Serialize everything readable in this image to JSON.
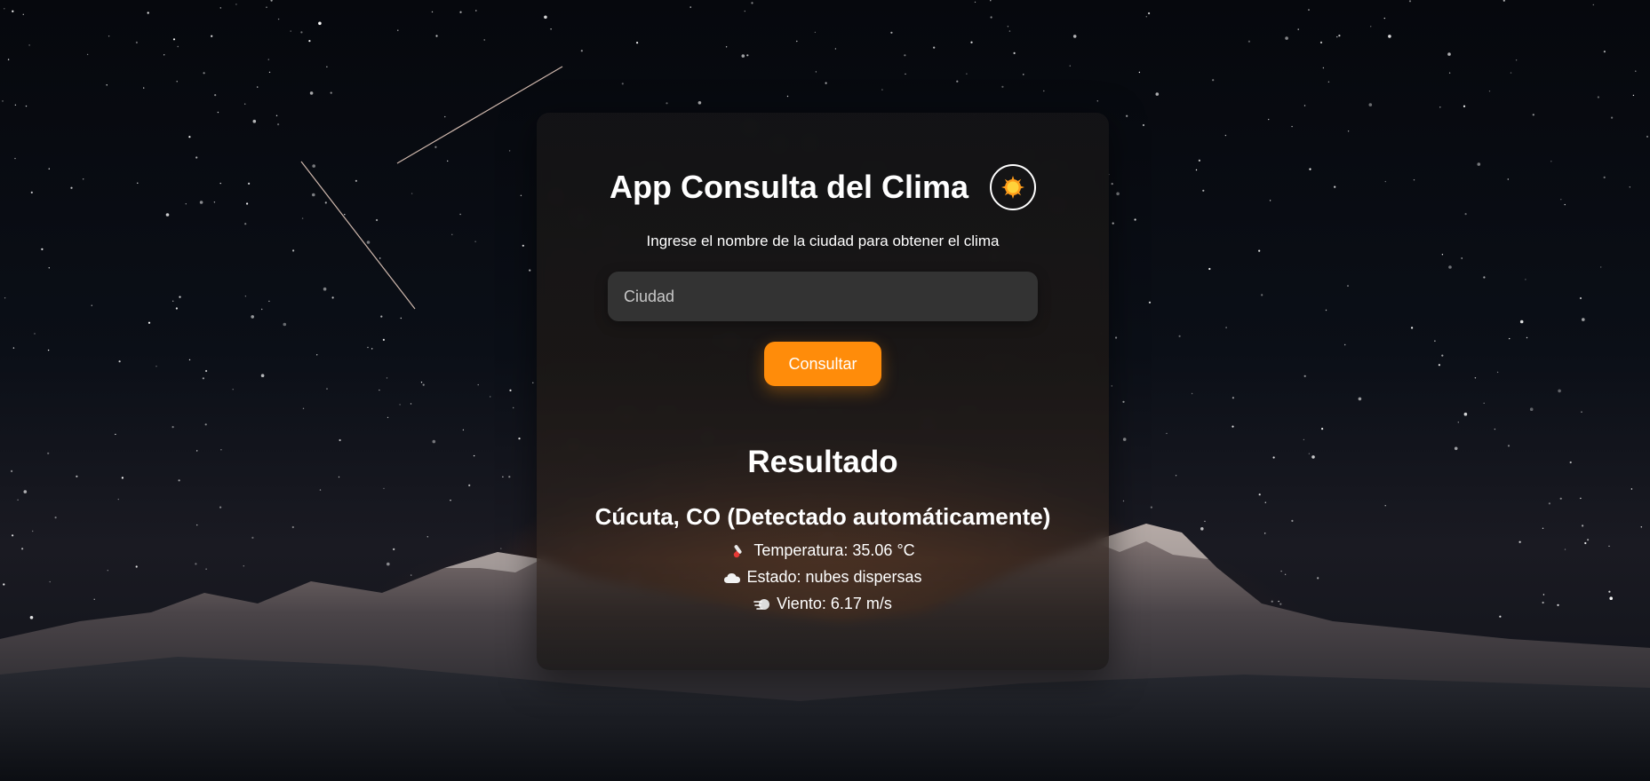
{
  "app": {
    "title": "App Consulta del Clima",
    "subtitle": "Ingrese el nombre de la ciudad para obtener el clima",
    "theme_icon": "sun-icon"
  },
  "search": {
    "placeholder": "Ciudad",
    "value": "",
    "button_label": "Consultar"
  },
  "result": {
    "heading": "Resultado",
    "location": "Cúcuta, CO (Detectado automáticamente)",
    "temperature_text": "Temperatura: 35.06 °C",
    "state_text": "Estado: nubes dispersas",
    "wind_text": "Viento: 6.17 m/s",
    "icons": [
      "thermometer-icon",
      "cloud-icon",
      "wind-icon"
    ]
  },
  "colors": {
    "accent": "#ff8c0a",
    "card": "#161616",
    "input": "#333333",
    "text": "#ffffff"
  }
}
